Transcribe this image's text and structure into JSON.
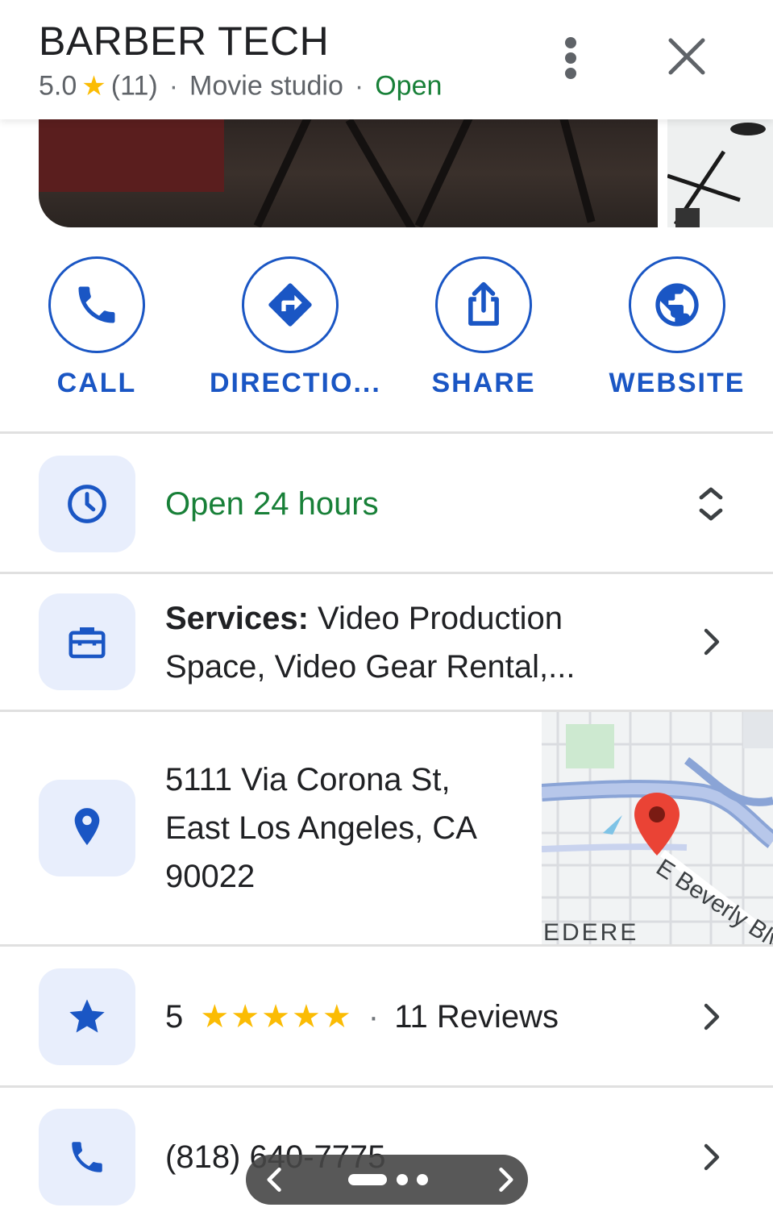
{
  "header": {
    "title": "BARBER TECH",
    "rating": "5.0",
    "review_count": "(11)",
    "category": "Movie studio",
    "status": "Open"
  },
  "actions": [
    {
      "label": "CALL",
      "icon": "phone-icon"
    },
    {
      "label": "DIRECTIO...",
      "icon": "directions-icon"
    },
    {
      "label": "SHARE",
      "icon": "share-icon"
    },
    {
      "label": "WEBSITE",
      "icon": "globe-icon"
    }
  ],
  "hours": {
    "text": "Open 24 hours"
  },
  "services": {
    "label": "Services:",
    "line1": " Video Production",
    "line2": "Space, Video Gear Rental,..."
  },
  "address": {
    "line1": "5111 Via Corona St,",
    "line2": "East Los Angeles, CA",
    "line3": "90022"
  },
  "map": {
    "street_label": "E Beverly Blv",
    "area_label": "EDERE"
  },
  "reviews": {
    "rating": "5",
    "stars": "★★★★★",
    "count_text": "11 Reviews"
  },
  "phone": {
    "number": "(818) 640-7775"
  },
  "colors": {
    "accent": "#1a56c4",
    "open_green": "#188038",
    "star": "#fbbc04",
    "icon_bg": "#e8eefc"
  }
}
